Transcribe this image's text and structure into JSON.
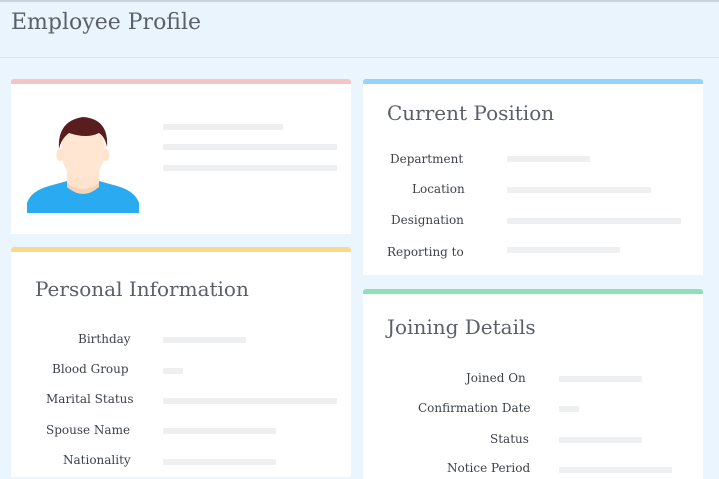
{
  "header": {
    "title": "Employee Profile"
  },
  "profile_card": {
    "avatar_icon": "user-avatar-icon",
    "accent": "#f7c4c5"
  },
  "position_card": {
    "title": "Current Position",
    "accent": "#94d4fa",
    "fields": [
      {
        "label": "Department"
      },
      {
        "label": "Location"
      },
      {
        "label": "Designation"
      },
      {
        "label": "Reporting to"
      }
    ]
  },
  "personal_card": {
    "title": "Personal Information",
    "accent": "#fbd98b",
    "fields": [
      {
        "label": "Birthday"
      },
      {
        "label": "Blood Group"
      },
      {
        "label": "Marital Status"
      },
      {
        "label": "Spouse Name"
      },
      {
        "label": "Nationality"
      }
    ]
  },
  "joining_card": {
    "title": "Joining Details",
    "accent": "#8ee0b9",
    "fields": [
      {
        "label": "Joined On"
      },
      {
        "label": "Confirmation Date"
      },
      {
        "label": "Status"
      },
      {
        "label": "Notice Period"
      }
    ]
  }
}
